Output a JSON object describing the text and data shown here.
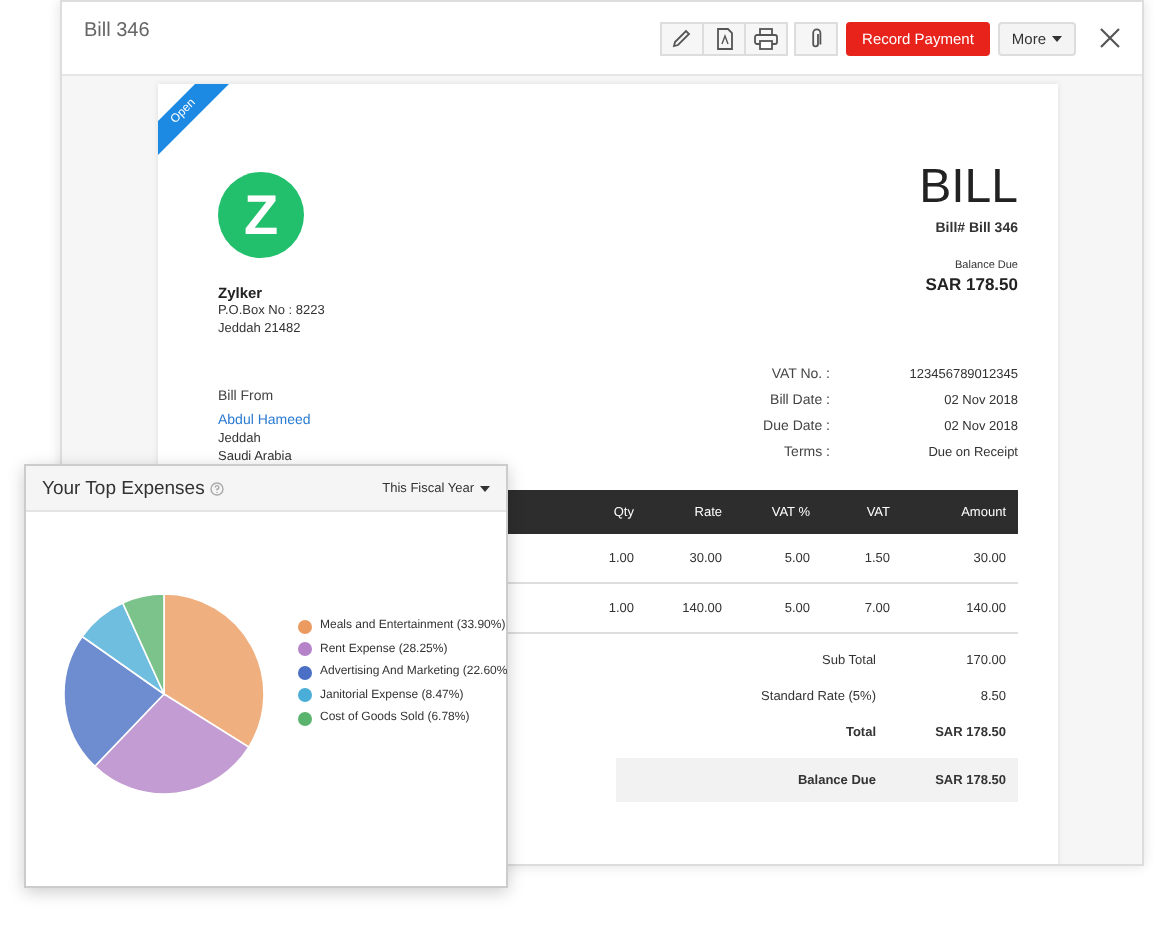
{
  "window": {
    "title": "Bill 346"
  },
  "toolbar": {
    "primary_button": "Record Payment",
    "more_button": "More"
  },
  "bill": {
    "status_ribbon": "Open",
    "logo_letter": "Z",
    "heading": "BILL",
    "bill_number": "Bill# Bill 346",
    "balance_due_label": "Balance Due",
    "balance_due": "SAR 178.50",
    "company": {
      "name": "Zylker",
      "lines": [
        "P.O.Box No : 8223",
        "Jeddah 21482"
      ]
    },
    "bill_from": {
      "label": "Bill From",
      "vendor": "Abdul Hameed",
      "lines": [
        "Jeddah",
        "Saudi Arabia"
      ]
    },
    "details": [
      {
        "label": "VAT No. :",
        "value": "123456789012345"
      },
      {
        "label": "Bill Date :",
        "value": "02 Nov 2018"
      },
      {
        "label": "Due Date :",
        "value": "02 Nov 2018"
      },
      {
        "label": "Terms :",
        "value": "Due on Receipt"
      }
    ],
    "table": {
      "columns": [
        "Qty",
        "Rate",
        "VAT %",
        "VAT",
        "Amount"
      ],
      "rows": [
        [
          "1.00",
          "30.00",
          "5.00",
          "1.50",
          "30.00"
        ],
        [
          "1.00",
          "140.00",
          "5.00",
          "7.00",
          "140.00"
        ]
      ]
    },
    "totals": [
      {
        "label": "Sub Total",
        "value": "170.00",
        "kind": "plain"
      },
      {
        "label": "Standard Rate (5%)",
        "value": "8.50",
        "kind": "plain"
      },
      {
        "label": "Total",
        "value": "SAR 178.50",
        "kind": "bold"
      },
      {
        "label": "Balance Due",
        "value": "SAR 178.50",
        "kind": "highlight"
      }
    ]
  },
  "expenses": {
    "title": "Your Top Expenses",
    "period": "This Fiscal Year",
    "legend": [
      {
        "color": "#eb9b5f"
      },
      {
        "color": "#b483c8"
      },
      {
        "color": "#4a6fc4"
      },
      {
        "color": "#4baed8"
      },
      {
        "color": "#5bb46e"
      }
    ],
    "chart_data": {
      "type": "pie",
      "categories": [
        "Meals and Entertainment",
        "Rent Expense",
        "Advertising And Marketing",
        "Janitorial Expense",
        "Cost of Goods Sold"
      ],
      "values": [
        33.9,
        28.25,
        22.6,
        8.47,
        6.78
      ],
      "value_labels": [
        "(33.90%)",
        "(28.25%)",
        "(22.60%",
        "(8.47%)",
        "(6.78%)"
      ]
    }
  }
}
